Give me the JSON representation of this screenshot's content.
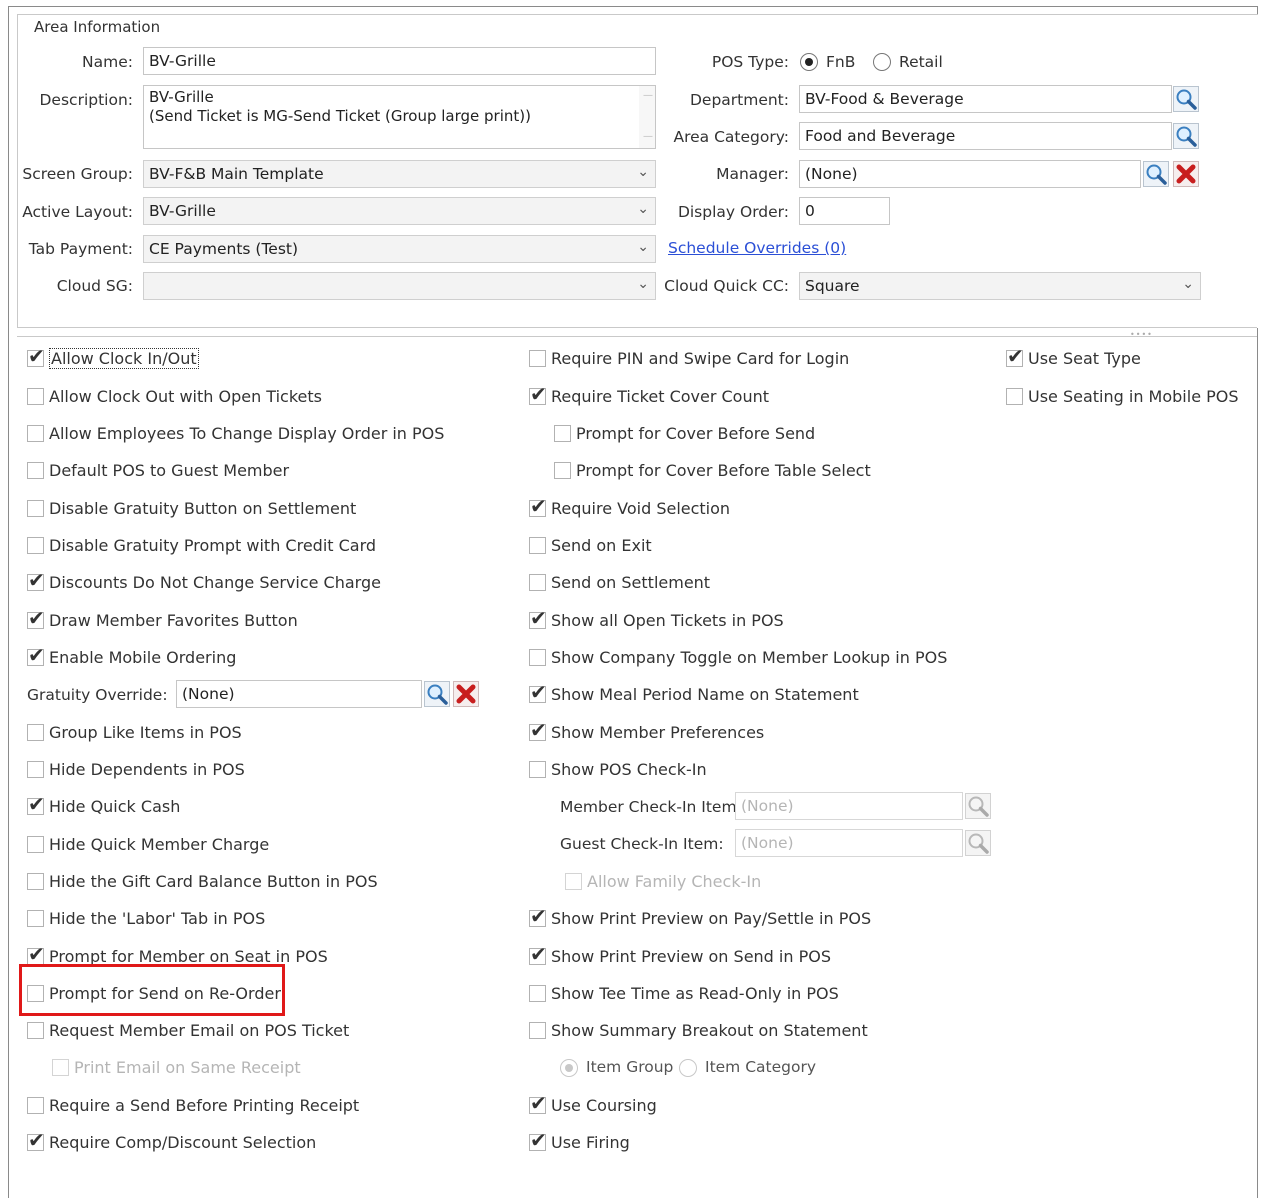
{
  "area_info": {
    "title": "Area Information",
    "name_label": "Name:",
    "name_value": "BV-Grille",
    "description_label": "Description:",
    "description_line1": "BV-Grille",
    "description_line2": "(Send Ticket is MG-Send Ticket (Group large print))",
    "screen_group_label": "Screen Group:",
    "screen_group_value": "BV-F&B Main Template",
    "active_layout_label": "Active Layout:",
    "active_layout_value": "BV-Grille",
    "tab_payment_label": "Tab Payment:",
    "tab_payment_value": "CE Payments (Test)",
    "cloud_sg_label": "Cloud SG:",
    "cloud_sg_value": "",
    "pos_type_label": "POS Type:",
    "pos_type_options": [
      "FnB",
      "Retail"
    ],
    "pos_type_selected": "FnB",
    "department_label": "Department:",
    "department_value": "BV-Food & Beverage",
    "area_category_label": "Area Category:",
    "area_category_value": "Food and Beverage",
    "manager_label": "Manager:",
    "manager_value": "(None)",
    "display_order_label": "Display Order:",
    "display_order_value": "0",
    "schedule_overrides_link": "Schedule Overrides (0)",
    "cloud_quick_cc_label": "Cloud Quick CC:",
    "cloud_quick_cc_value": "Square"
  },
  "options_col1": [
    {
      "label": "Allow Clock In/Out",
      "checked": true
    },
    {
      "label": "Allow Clock Out with Open Tickets",
      "checked": false
    },
    {
      "label": "Allow Employees To Change Display Order in POS",
      "checked": false
    },
    {
      "label": "Default POS to Guest Member",
      "checked": false
    },
    {
      "label": "Disable Gratuity Button on Settlement",
      "checked": false
    },
    {
      "label": "Disable Gratuity Prompt with Credit Card",
      "checked": false
    },
    {
      "label": "Discounts Do Not Change Service Charge",
      "checked": true
    },
    {
      "label": "Draw Member Favorites Button",
      "checked": true
    },
    {
      "label": "Enable Mobile Ordering",
      "checked": true
    },
    {
      "label": "Group Like Items in POS",
      "checked": false
    },
    {
      "label": "Hide Dependents in POS",
      "checked": false
    },
    {
      "label": "Hide Quick Cash",
      "checked": true
    },
    {
      "label": "Hide Quick Member Charge",
      "checked": false
    },
    {
      "label": "Hide the Gift Card Balance Button in POS",
      "checked": false
    },
    {
      "label": "Hide the 'Labor' Tab in POS",
      "checked": false
    },
    {
      "label": "Prompt for Member on Seat in POS",
      "checked": true
    },
    {
      "label": "Prompt for Send on Re-Order",
      "checked": false
    },
    {
      "label": "Request Member Email on POS Ticket",
      "checked": false
    },
    {
      "label": "Print Email on Same Receipt",
      "checked": false
    },
    {
      "label": "Require a Send Before Printing Receipt",
      "checked": false
    },
    {
      "label": "Require Comp/Discount Selection",
      "checked": true
    }
  ],
  "gratuity_override": {
    "label": "Gratuity Override:",
    "value": "(None)"
  },
  "options_col2": [
    {
      "label": "Require PIN and Swipe Card for Login",
      "checked": false
    },
    {
      "label": "Require Ticket Cover Count",
      "checked": true
    },
    {
      "label": "Prompt for Cover Before Send",
      "checked": false
    },
    {
      "label": "Prompt for Cover Before Table Select",
      "checked": false
    },
    {
      "label": "Require Void Selection",
      "checked": true
    },
    {
      "label": "Send on Exit",
      "checked": false
    },
    {
      "label": "Send on Settlement",
      "checked": false
    },
    {
      "label": "Show all Open Tickets in POS",
      "checked": true
    },
    {
      "label": "Show Company Toggle on Member Lookup in POS",
      "checked": false
    },
    {
      "label": "Show Meal Period Name on Statement",
      "checked": true
    },
    {
      "label": "Show Member Preferences",
      "checked": true
    },
    {
      "label": "Show POS Check-In",
      "checked": false
    },
    {
      "label": "Allow Family Check-In",
      "checked": false
    },
    {
      "label": "Show Print Preview on Pay/Settle in POS",
      "checked": true
    },
    {
      "label": "Show Print Preview on Send in POS",
      "checked": true
    },
    {
      "label": "Show Tee Time as Read-Only in POS",
      "checked": false
    },
    {
      "label": "Show Summary Breakout on Statement",
      "checked": false
    },
    {
      "label": "Use Coursing",
      "checked": true
    },
    {
      "label": "Use Firing",
      "checked": true
    }
  ],
  "checkin": {
    "member_label": "Member Check-In Item:",
    "member_value": "(None)",
    "guest_label": "Guest Check-In Item:",
    "guest_value": "(None)"
  },
  "breakout_radio": {
    "options": [
      "Item Group",
      "Item Category"
    ],
    "selected": "Item Group"
  },
  "options_col3": [
    {
      "label": "Use Seat Type",
      "checked": true
    },
    {
      "label": "Use Seating in Mobile POS",
      "checked": false
    }
  ],
  "colors": {
    "highlight": "#e01818",
    "link": "#2b4fd6"
  }
}
